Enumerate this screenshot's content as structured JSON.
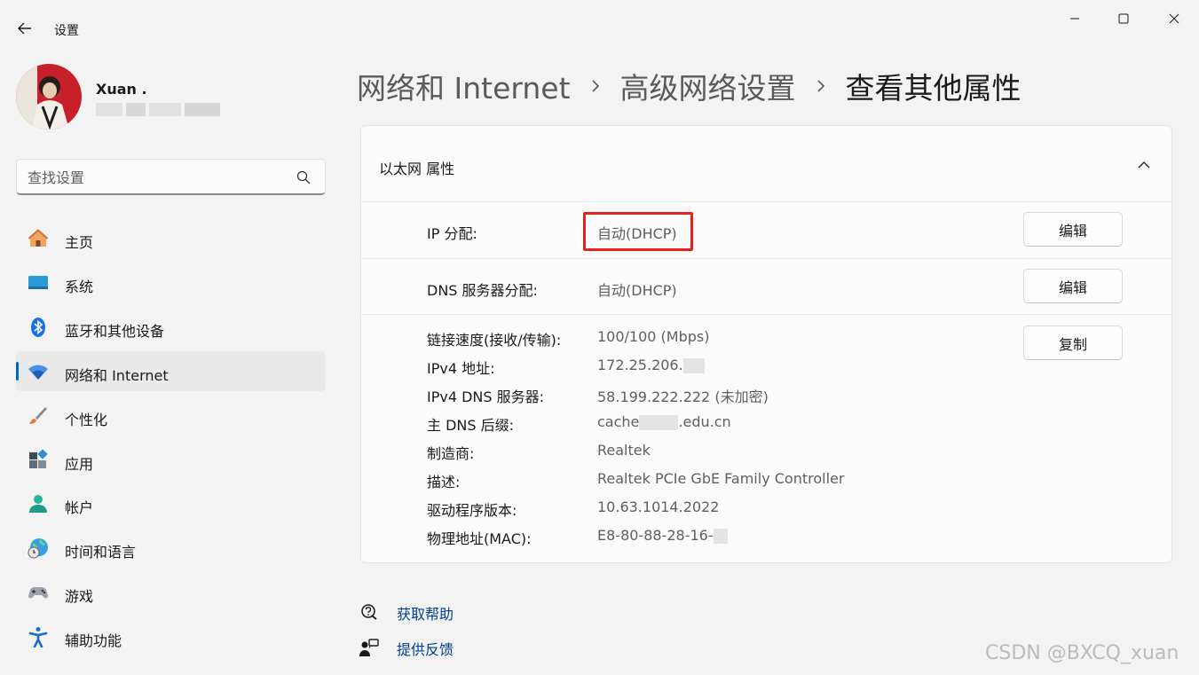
{
  "window": {
    "app_title": "设置",
    "icons": {
      "back": "back-arrow-icon",
      "minimize": "minimize-icon",
      "maximize": "maximize-icon",
      "close": "close-icon"
    }
  },
  "user": {
    "name": "Xuan ."
  },
  "search": {
    "placeholder": "查找设置",
    "icon": "search-icon"
  },
  "sidebar": {
    "items": [
      {
        "label": "主页",
        "icon": "home-icon",
        "active": false
      },
      {
        "label": "系统",
        "icon": "system-icon",
        "active": false
      },
      {
        "label": "蓝牙和其他设备",
        "icon": "bluetooth-icon",
        "active": false
      },
      {
        "label": "网络和 Internet",
        "icon": "wifi-icon",
        "active": true
      },
      {
        "label": "个性化",
        "icon": "brush-icon",
        "active": false
      },
      {
        "label": "应用",
        "icon": "apps-icon",
        "active": false
      },
      {
        "label": "帐户",
        "icon": "account-icon",
        "active": false
      },
      {
        "label": "时间和语言",
        "icon": "globe-clock-icon",
        "active": false
      },
      {
        "label": "游戏",
        "icon": "gamepad-icon",
        "active": false
      },
      {
        "label": "辅助功能",
        "icon": "accessibility-icon",
        "active": false
      }
    ]
  },
  "breadcrumb": {
    "items": [
      "网络和 Internet",
      "高级网络设置"
    ],
    "current": "查看其他属性"
  },
  "card": {
    "title": "以太网 属性",
    "ip_assignment": {
      "label": "IP 分配:",
      "value": "自动(DHCP)",
      "button": "编辑"
    },
    "dns_assignment": {
      "label": "DNS 服务器分配:",
      "value": "自动(DHCP)",
      "button": "编辑"
    },
    "copy_button": "复制",
    "properties": [
      {
        "label": "链接速度(接收/传输):",
        "value": "100/100 (Mbps)"
      },
      {
        "label": "IPv4 地址:",
        "value": "172.25.206."
      },
      {
        "label": "IPv4 DNS 服务器:",
        "value": "58.199.222.222 (未加密)"
      },
      {
        "label": "主 DNS 后缀:",
        "value_prefix": "cache",
        "value_suffix": ".edu.cn"
      },
      {
        "label": "制造商:",
        "value": "Realtek"
      },
      {
        "label": "描述:",
        "value": "Realtek PCIe GbE Family Controller"
      },
      {
        "label": "驱动程序版本:",
        "value": "10.63.1014.2022"
      },
      {
        "label": "物理地址(MAC):",
        "value": "E8-80-88-28-16-"
      }
    ]
  },
  "links": [
    {
      "label": "获取帮助",
      "icon": "help-icon"
    },
    {
      "label": "提供反馈",
      "icon": "feedback-icon"
    }
  ],
  "watermark": "CSDN @BXCQ_xuan",
  "colors": {
    "accent": "#0067c0",
    "highlight_border": "#e8221b",
    "link": "#003e92"
  }
}
